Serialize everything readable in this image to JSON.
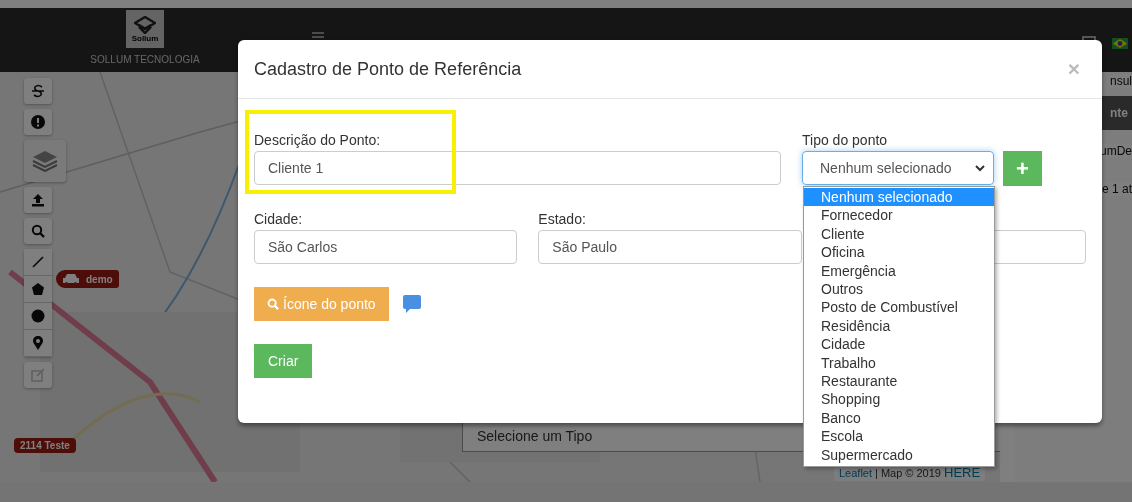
{
  "header": {
    "logo_text": "Sollum",
    "brand": "SOLLUM TECNOLOGIA"
  },
  "right_panel": {
    "fragments": [
      "nsul",
      "nte",
      "umDe",
      "e 1 at"
    ]
  },
  "map": {
    "markers": [
      {
        "label": "demo"
      },
      {
        "label": "2114 Teste"
      }
    ],
    "type_select": {
      "value": "Selecione um Tipo"
    },
    "attribution": {
      "link": "Leaflet",
      "separator": "|",
      "text": "Map © 2019",
      "provider": "HERE"
    }
  },
  "modal": {
    "title": "Cadastro de Ponto de Referência",
    "close": "×",
    "description": {
      "label": "Descrição do Ponto:",
      "value": "Cliente 1"
    },
    "type": {
      "label": "Tipo do ponto",
      "value": "Nenhum selecionado",
      "add": "+",
      "options": [
        {
          "label": "Nenhum selecionado",
          "selected": true
        },
        {
          "label": "Fornecedor",
          "selected": false
        },
        {
          "label": "Cliente",
          "selected": false
        },
        {
          "label": "Oficina",
          "selected": false
        },
        {
          "label": "Emergência",
          "selected": false
        },
        {
          "label": "Outros",
          "selected": false
        },
        {
          "label": "Posto de Combustível",
          "selected": false
        },
        {
          "label": "Residência",
          "selected": false
        },
        {
          "label": "Cidade",
          "selected": false
        },
        {
          "label": "Trabalho",
          "selected": false
        },
        {
          "label": "Restaurante",
          "selected": false
        },
        {
          "label": "Shopping",
          "selected": false
        },
        {
          "label": "Banco",
          "selected": false
        },
        {
          "label": "Escola",
          "selected": false
        },
        {
          "label": "Supermercado",
          "selected": false
        }
      ]
    },
    "city": {
      "label": "Cidade:",
      "value": "São Carlos"
    },
    "state": {
      "label": "Estado:",
      "value": "São Paulo"
    },
    "icon_button": "Ícone do ponto",
    "submit": "Criar"
  }
}
